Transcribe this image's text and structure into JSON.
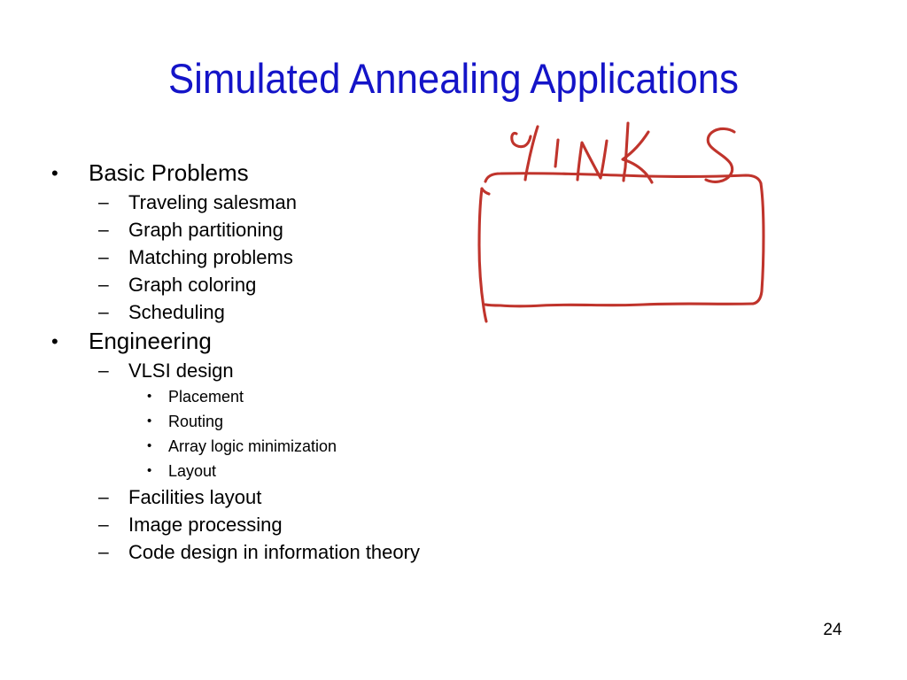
{
  "slide": {
    "title": "Simulated Annealing Applications",
    "number": "24",
    "title_color": "#1414c8",
    "body_color": "#000000",
    "background_color": "#ffffff"
  },
  "markers": {
    "level1": "•",
    "level2": "–",
    "level3": "•"
  },
  "body": {
    "items": [
      {
        "level": 1,
        "text": "Basic Problems"
      },
      {
        "level": 2,
        "text": "Traveling salesman"
      },
      {
        "level": 2,
        "text": "Graph partitioning"
      },
      {
        "level": 2,
        "text": "Matching problems"
      },
      {
        "level": 2,
        "text": "Graph coloring"
      },
      {
        "level": 2,
        "text": "Scheduling"
      },
      {
        "level": 1,
        "text": "Engineering"
      },
      {
        "level": 2,
        "text": "VLSI design"
      },
      {
        "level": 3,
        "text": "Placement"
      },
      {
        "level": 3,
        "text": "Routing"
      },
      {
        "level": 3,
        "text": "Array logic minimization"
      },
      {
        "level": 3,
        "text": "Layout"
      },
      {
        "level": 2,
        "text": "Facilities layout"
      },
      {
        "level": 2,
        "text": "Image processing"
      },
      {
        "level": 2,
        "text": "Code design in information theory"
      }
    ]
  },
  "annotation": {
    "ink_color": "#c0342c",
    "handwritten_word": "LINKS",
    "shape": "rectangle",
    "description": "Red handwritten word 'LINKS' above a hand-drawn red rectangle"
  }
}
